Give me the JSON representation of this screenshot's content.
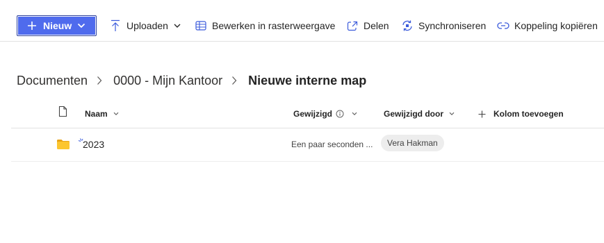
{
  "command_bar": {
    "new_label": "Nieuw",
    "upload_label": "Uploaden",
    "grid_edit_label": "Bewerken in rasterweergave",
    "share_label": "Delen",
    "sync_label": "Synchroniseren",
    "copy_link_label": "Koppeling kopiëren",
    "accent_color": "#4f6bed"
  },
  "breadcrumb": {
    "items": [
      "Documenten",
      "0000 - Mijn Kantoor"
    ],
    "current": "Nieuwe interne map"
  },
  "columns": {
    "name": "Naam",
    "modified": "Gewijzigd",
    "modified_by": "Gewijzigd door",
    "add_column": "Kolom toevoegen"
  },
  "rows": [
    {
      "type": "folder",
      "name": "2023",
      "modified": "Een paar seconden ...",
      "modified_by": "Vera Hakman"
    }
  ]
}
